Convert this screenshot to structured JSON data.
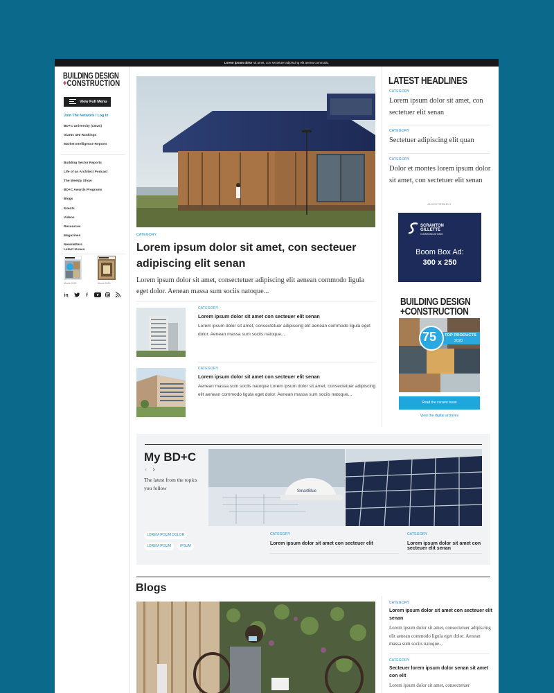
{
  "topbar": {
    "bold": "Lorem ipsum dolor",
    "rest": " sit amet, con sectetuer adipiscing elit aenea commodo."
  },
  "logo": {
    "line1": "BUILDING DESIGN",
    "plus": "+",
    "line2": "CONSTRUCTION"
  },
  "sidebar": {
    "menu_button": "View Full Menu",
    "join": "Join The Network / Log In",
    "group1": [
      "BD+C University (CEUs)",
      "Giants 400 Rankings",
      "Market Intelligence Reports"
    ],
    "group2": [
      "Building Sector Reports",
      "Life of an Architect Podcast",
      "The Weekly Show",
      "BD+C Awards Programs",
      "Blogs",
      "Events",
      "Videos",
      "Resources",
      "Magazines",
      "Newsletters"
    ],
    "latest_issues_title": "Latest Issues",
    "issues": [
      {
        "caption": "Month 2020"
      },
      {
        "caption": "Month 2020"
      }
    ],
    "social": [
      {
        "icon": "linkedin-icon",
        "glyph": "in"
      },
      {
        "icon": "twitter-icon",
        "glyph": "🐦"
      },
      {
        "icon": "facebook-icon",
        "glyph": "f"
      },
      {
        "icon": "youtube-icon",
        "glyph": "▶"
      },
      {
        "icon": "instagram-icon",
        "glyph": "◎"
      },
      {
        "icon": "rss-icon",
        "glyph": "☰"
      }
    ]
  },
  "hero": {
    "category": "CATEGORY",
    "title": "Lorem ipsum dolor sit amet, con secteuer adipiscing elit senan",
    "excerpt": "Lorem ipsum dolor sit amet, consectetuer adipiscing elit aenean commodo ligula eget dolor. Aenean massa sum sociis natoque..."
  },
  "cards": [
    {
      "category": "CATEGORY",
      "title": "Lorem ipsum dolor sit amet con secteuer elit senan",
      "excerpt": "Lorem ipsum dolor sit amet, consectetuer adipiscing elit aenean commodo ligula eget dolor. Aenean massa sum sociis natoque..."
    },
    {
      "category": "CATEGORY",
      "title": "Lorem ipsum dolor sit amet con secteuer elit senan",
      "excerpt": "Aenean massa sum sociis natoque Lorem ipsum dolor sit amet, consectetuer adipiscing elit aenean commodo ligula eget dolor. Aenean massa sum sociis natoque..."
    }
  ],
  "latest_headlines": {
    "title": "LATEST HEADLINES",
    "items": [
      {
        "category": "CATEGORY",
        "title": "Lorem ipsum dolor sit amet, con sectetuer elit senan"
      },
      {
        "category": "CATEGORY",
        "title": "Sectetuer adipiscing elit quan"
      },
      {
        "category": "CATEGORY",
        "title": "Dolor et montes lorem ipsum dolor sit amet, con sectetuer elit senan"
      }
    ]
  },
  "ad": {
    "label": "ADVERTISEMENT",
    "logo_lines": [
      "SCRANTON",
      "GILLETTE",
      "COMMUNICATIONS"
    ],
    "line1": "Boom Box Ad:",
    "line2": "300 x 250"
  },
  "magazine": {
    "title1": "BUILDING DESIGN",
    "title2": "+CONSTRUCTION",
    "number": "75",
    "products": "TOP PRODUCTS",
    "year": "2020",
    "read_button": "Read the current issue",
    "archives_link": "View the digital archives"
  },
  "mybdc": {
    "title": "My BD+C",
    "prev": "‹",
    "next": "›",
    "subtitle": "The latest from the topics you follow",
    "tags": [
      "LOREM IPSUM DOLOR",
      "LOREM IPSUM",
      "IPSUM"
    ],
    "items": [
      {
        "category": "CATEGORY",
        "title": "Lorem ipsum dolor sit amet con secteuer elit"
      },
      {
        "category": "CATEGORY",
        "title": "Lorem ipsum dolor sit amet con secteuer elit senan"
      }
    ]
  },
  "blogs": {
    "title": "Blogs",
    "items": [
      {
        "category": "CATEGORY",
        "title": "Lorem ipsum dolor sit amet con secteuer elit senan",
        "excerpt": "Lorem ipsum dolor sit amet, consectetuer adipiscing elit aenean commodo ligula eget dolor. Aenean massa sum sociis natoque..."
      },
      {
        "category": "CATEGORY",
        "title": "Secteuer lorem ipsum dolor senan sit amet con elit",
        "excerpt": "Lorem ipsum dolor sit amet, consectetuer"
      }
    ]
  }
}
